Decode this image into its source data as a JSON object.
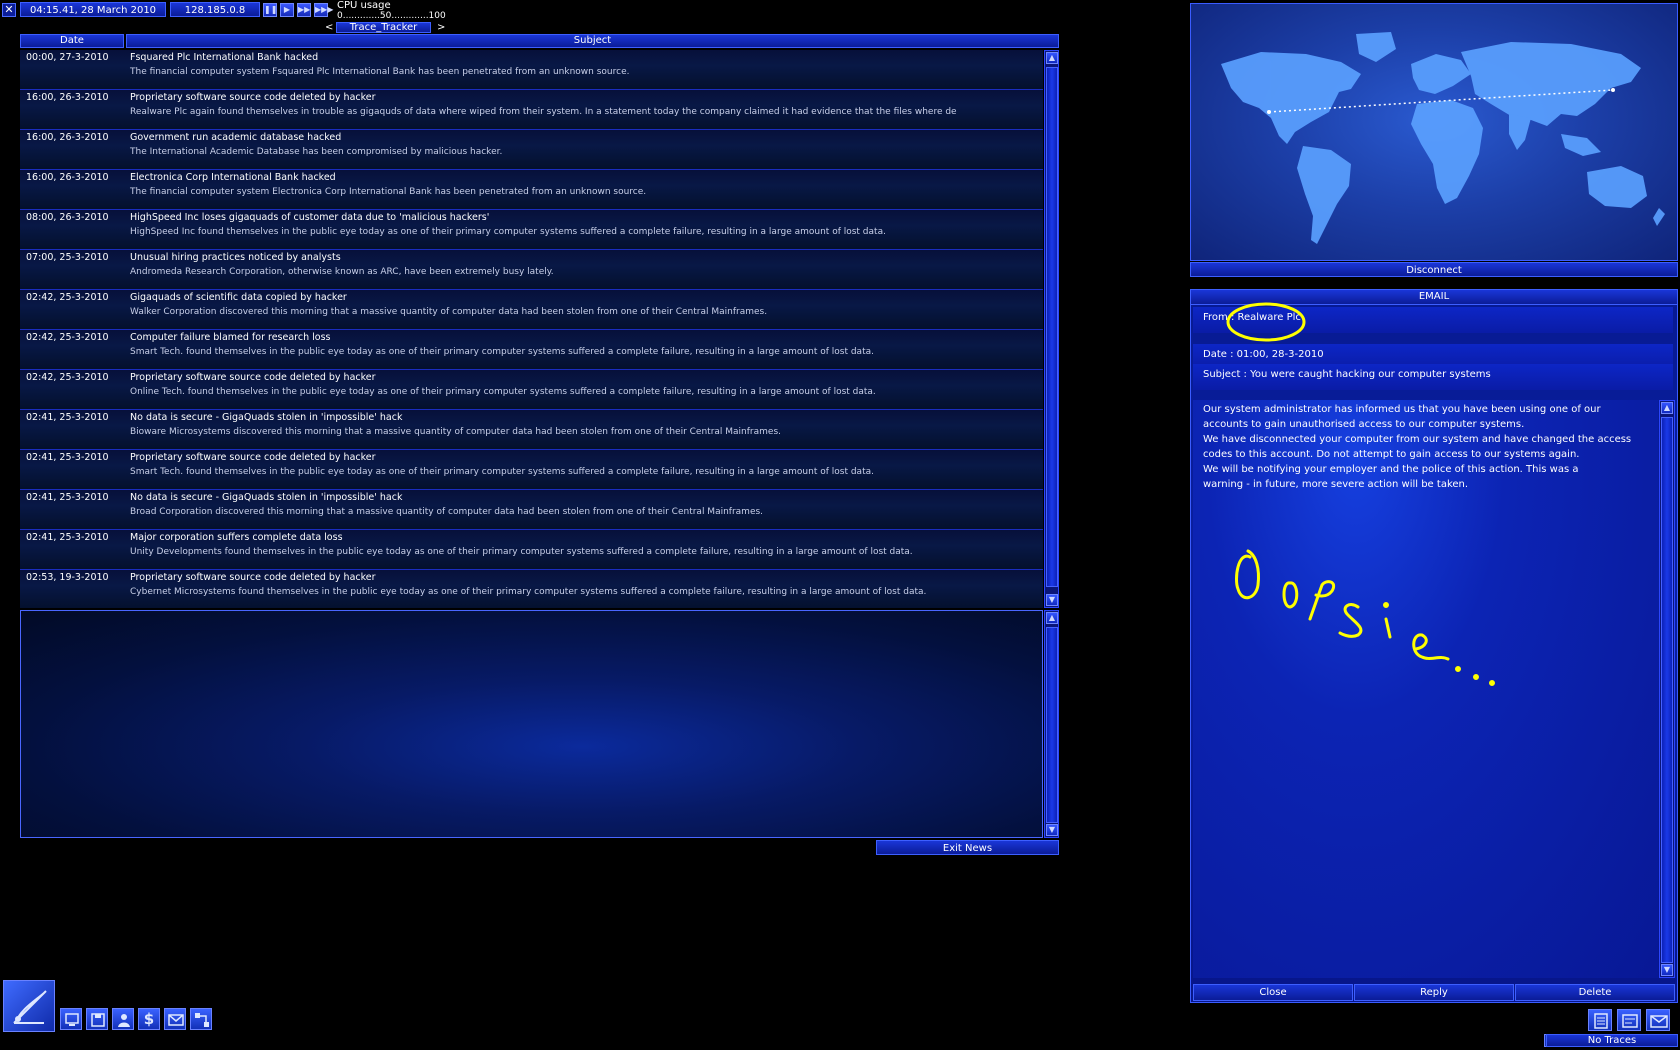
{
  "topbar": {
    "close_glyph": "✕",
    "datetime": "04:15.41, 28 March 2010",
    "ip": "128.185.0.8",
    "speed_buttons": [
      "❚❚",
      "▶",
      "▶▶",
      "▶▶▶"
    ],
    "cpu_label": "CPU usage",
    "cpu_scale": "0.............50.............100",
    "trace_left": "<",
    "trace_label": "Trace_Tracker",
    "trace_right": ">"
  },
  "news": {
    "header_date": "Date",
    "header_subject": "Subject",
    "items": [
      {
        "date": "00:00, 27-3-2010",
        "title": "Fsquared Plc International Bank hacked",
        "body": "The financial computer system Fsquared Plc International Bank has been penetrated from an unknown source."
      },
      {
        "date": "16:00, 26-3-2010",
        "title": "Proprietary software source code deleted by hacker",
        "body": "Realware Plc again found themselves in trouble as gigaquds of data where wiped from their system.  In a statement today the company claimed it had evidence that the files where de"
      },
      {
        "date": "16:00, 26-3-2010",
        "title": "Government run academic database hacked",
        "body": "The International Academic Database has been compromised by  malicious hacker."
      },
      {
        "date": "16:00, 26-3-2010",
        "title": "Electronica Corp International Bank hacked",
        "body": "The financial computer system Electronica Corp International Bank has been penetrated from an unknown source."
      },
      {
        "date": "08:00, 26-3-2010",
        "title": "HighSpeed Inc loses gigaquads of customer data due to 'malicious hackers'",
        "body": "HighSpeed Inc found themselves in the public eye today as one of their primary computer systems suffered a complete failure, resulting in a large amount of lost data."
      },
      {
        "date": "07:00, 25-3-2010",
        "title": "Unusual hiring practices noticed by analysts",
        "body": "Andromeda Research Corporation, otherwise known as ARC, have been extremely busy lately."
      },
      {
        "date": "02:42, 25-3-2010",
        "title": "Gigaquads of scientific data copied by hacker",
        "body": "Walker Corporation discovered this morning that a massive quantity of computer data had been stolen from one of their Central Mainframes."
      },
      {
        "date": "02:42, 25-3-2010",
        "title": "Computer failure blamed for research loss",
        "body": "Smart Tech. found themselves in the public eye today as one of their primary computer systems suffered a complete failure, resulting in a large amount of lost data."
      },
      {
        "date": "02:42, 25-3-2010",
        "title": "Proprietary software source code deleted by hacker",
        "body": "Online Tech. found themselves in the public eye today as one of their primary computer systems suffered a complete failure, resulting in a large amount of lost data."
      },
      {
        "date": "02:41, 25-3-2010",
        "title": "No data is secure - GigaQuads stolen in 'impossible' hack",
        "body": "Bioware Microsystems discovered this morning that a massive quantity of computer data had been stolen from one of their Central Mainframes."
      },
      {
        "date": "02:41, 25-3-2010",
        "title": "Proprietary software source code deleted by hacker",
        "body": "Smart Tech. found themselves in the public eye today as one of their primary computer systems suffered a complete failure, resulting in a large amount of lost data."
      },
      {
        "date": "02:41, 25-3-2010",
        "title": "No data is secure - GigaQuads stolen in 'impossible' hack",
        "body": "Broad Corporation discovered this morning that a massive quantity of computer data had been stolen from one of their Central Mainframes."
      },
      {
        "date": "02:41, 25-3-2010",
        "title": "Major corporation suffers complete data loss",
        "body": "Unity Developments found themselves in the public eye today as one of their primary computer systems suffered a complete failure, resulting in a large amount of lost data."
      },
      {
        "date": "02:53, 19-3-2010",
        "title": "Proprietary software source code deleted by hacker",
        "body": "Cybernet Microsystems found themselves in the public eye today as one of their primary computer systems suffered a complete failure, resulting in a large amount of lost data."
      }
    ],
    "exit_label": "Exit News"
  },
  "map": {
    "disconnect_label": "Disconnect"
  },
  "email": {
    "title": "EMAIL",
    "from": "From : Realware Plc",
    "date": "Date : 01:00, 28-3-2010",
    "subject": "Subject : You were caught hacking our computer systems",
    "body_lines": [
      "Our system administrator has informed us that you have been using one of our",
      "accounts to gain unauthorised access to our computer systems.",
      "We have disconnected your computer from our system and have changed the access",
      "codes to this account.  Do not attempt to gain access to our systems again.",
      "We will be notifying your employer and the police of this action.  This was a",
      "warning - in future, more severe action will be taken."
    ],
    "annotation_handwriting": "Oopsie...",
    "annotation_color": "#ffff00",
    "buttons": {
      "close": "Close",
      "reply": "Reply",
      "delete": "Delete"
    }
  },
  "dock": {
    "icons": [
      "gateway-logo-icon",
      "computer-icon",
      "save-disk-icon",
      "person-icon",
      "dollar-icon",
      "mail-envelope-icon",
      "network-icon"
    ],
    "dollar_glyph": "$"
  },
  "status": {
    "traces": "No Traces"
  },
  "colors": {
    "accent": "#1a36d8",
    "border": "#3a5cff",
    "background": "#000000"
  }
}
